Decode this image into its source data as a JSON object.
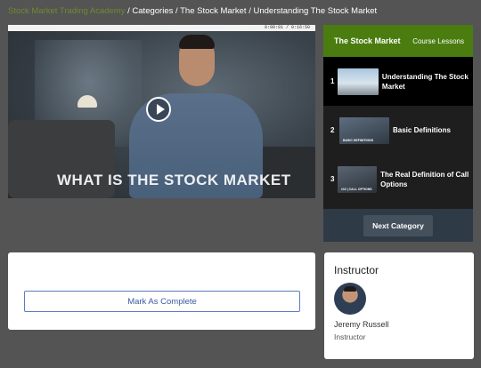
{
  "breadcrumb": {
    "home": "Stock Market Trading Academy",
    "items": [
      "Categories",
      "The Stock Market",
      "Understanding The Stock Market"
    ],
    "separator": " / "
  },
  "video": {
    "time": "0:00:01 / 0:16:50",
    "overlay_text": "WHAT IS THE STOCK MARKET"
  },
  "lessons_panel": {
    "title": "The Stock Market",
    "subtitle": "Course Lessons",
    "lessons": [
      {
        "number": "1",
        "label": "Understanding The Stock Market",
        "thumb_caption": ""
      },
      {
        "number": "2",
        "label": "Basic Definitions",
        "thumb_caption": "BASIC DEFINITIONS"
      },
      {
        "number": "3",
        "label": "The Real Definition of Call Options",
        "thumb_caption": "#10 | CALL OPTIONS"
      }
    ],
    "next_button": "Next Category"
  },
  "complete": {
    "button": "Mark As Complete"
  },
  "instructor": {
    "heading": "Instructor",
    "name": "Jeremy Russell",
    "role": "Instructor"
  },
  "colors": {
    "background": "#545454",
    "accent_green": "#4a7c10",
    "button_blue": "#3b5aa0"
  }
}
